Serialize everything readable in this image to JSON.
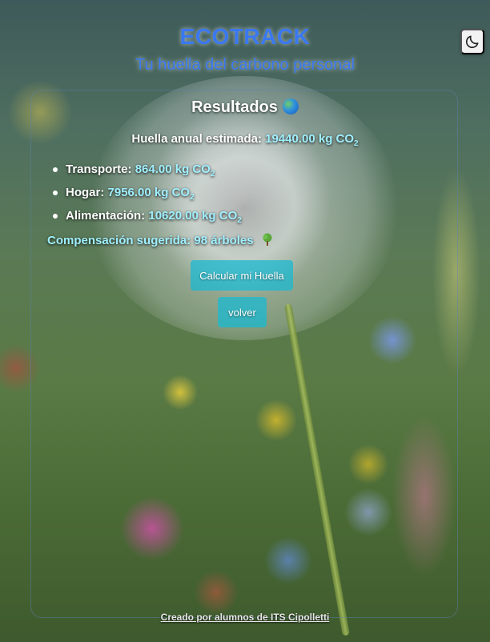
{
  "header": {
    "brand": "ECOTRACK",
    "subtitle": "Tu huella del carbono personal"
  },
  "theme_toggle": {
    "icon": "moon-icon"
  },
  "results": {
    "title": "Resultados",
    "title_icon": "globe-icon",
    "annual_label": "Huella anual estimada:",
    "annual_value": "19440.00 kg CO",
    "annual_sub": "2",
    "breakdown": [
      {
        "label": "Transporte:",
        "value": "864.00 kg CO",
        "sub": "2"
      },
      {
        "label": "Hogar:",
        "value": "7956.00 kg CO",
        "sub": "2"
      },
      {
        "label": "Alimentación:",
        "value": "10620.00 kg CO",
        "sub": "2"
      }
    ],
    "offset_text": "Compensación sugerida: 98 árboles",
    "offset_icon": "tree-icon"
  },
  "buttons": {
    "calculate": "Calcular mi Huella",
    "back": "volver"
  },
  "footer": {
    "credit": "Creado por alumnos de ITS Cipolletti"
  },
  "colors": {
    "brand": "#3a78f0",
    "value_accent": "#9ff0ff",
    "button": "#19b9d2"
  }
}
